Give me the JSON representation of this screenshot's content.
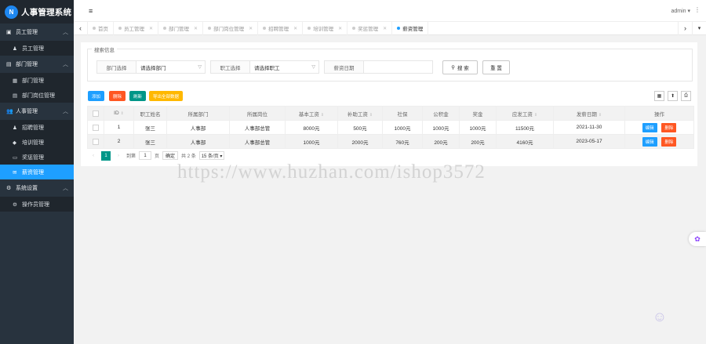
{
  "app": {
    "title": "人事管理系统",
    "logo_text": "N"
  },
  "topbar": {
    "menu_icon": "≡",
    "user": "admin ▾",
    "more": "⋮"
  },
  "sidebar": {
    "groups": [
      {
        "label": "员工管理",
        "icon": "▣",
        "items": [
          {
            "label": "员工管理",
            "icon": "♟"
          }
        ]
      },
      {
        "label": "部门管理",
        "icon": "▤",
        "items": [
          {
            "label": "部门管理",
            "icon": "▦"
          },
          {
            "label": "部门岗位管理",
            "icon": "▤"
          }
        ]
      },
      {
        "label": "人事管理",
        "icon": "👥",
        "items": [
          {
            "label": "招聘管理",
            "icon": "♟"
          },
          {
            "label": "培训管理",
            "icon": "◆"
          },
          {
            "label": "奖惩管理",
            "icon": "▭"
          },
          {
            "label": "薪资管理",
            "icon": "✉"
          }
        ]
      },
      {
        "label": "系统设置",
        "icon": "⚙",
        "items": [
          {
            "label": "操作员管理",
            "icon": "⚙"
          }
        ]
      }
    ]
  },
  "tabs": [
    {
      "label": "首页",
      "closable": false
    },
    {
      "label": "员工管理",
      "closable": true
    },
    {
      "label": "部门管理",
      "closable": true
    },
    {
      "label": "部门岗位管理",
      "closable": true
    },
    {
      "label": "招聘管理",
      "closable": true
    },
    {
      "label": "培训管理",
      "closable": true
    },
    {
      "label": "奖惩管理",
      "closable": true
    },
    {
      "label": "薪资管理",
      "closable": true,
      "active": true
    }
  ],
  "search": {
    "legend": "搜索信息",
    "dept_label": "部门选择",
    "dept_value": "请选择部门",
    "emp_label": "职工选择",
    "emp_value": "请选择职工",
    "date_label": "薪资日期",
    "date_value": "",
    "search_btn": "搜 索",
    "reset_btn": "重 置"
  },
  "toolbar": {
    "add": "添加",
    "delete": "删除",
    "refresh": "刷新",
    "export": "导出全部数据",
    "add_color": "#1e9fff",
    "delete_color": "#ff5722",
    "refresh_color": "#009688",
    "export_color": "#ffb800"
  },
  "table": {
    "headers": [
      "ID",
      "职工姓名",
      "所属部门",
      "所属岗位",
      "基本工资",
      "补助工资",
      "社保",
      "公积金",
      "奖金",
      "应发工资",
      "发薪日期",
      "操作"
    ],
    "rows": [
      [
        "1",
        "张三",
        "人事部",
        "人事部总管",
        "8000元",
        "500元",
        "1000元",
        "1000元",
        "1000元",
        "11500元",
        "2021-11-30"
      ],
      [
        "2",
        "张三",
        "人事部",
        "人事部总管",
        "1000元",
        "2000元",
        "760元",
        "200元",
        "200元",
        "4160元",
        "2023-05-17"
      ]
    ],
    "edit_label": "编辑",
    "delete_label": "删除"
  },
  "pager": {
    "prev": "‹",
    "current": "1",
    "next": "›",
    "goto_label": "到第",
    "goto_value": "1",
    "page_unit": "页",
    "confirm": "确定",
    "total": "共 2 条",
    "page_size": "15 条/页 ▾"
  },
  "watermark": "https://www.huzhan.com/ishop3572"
}
